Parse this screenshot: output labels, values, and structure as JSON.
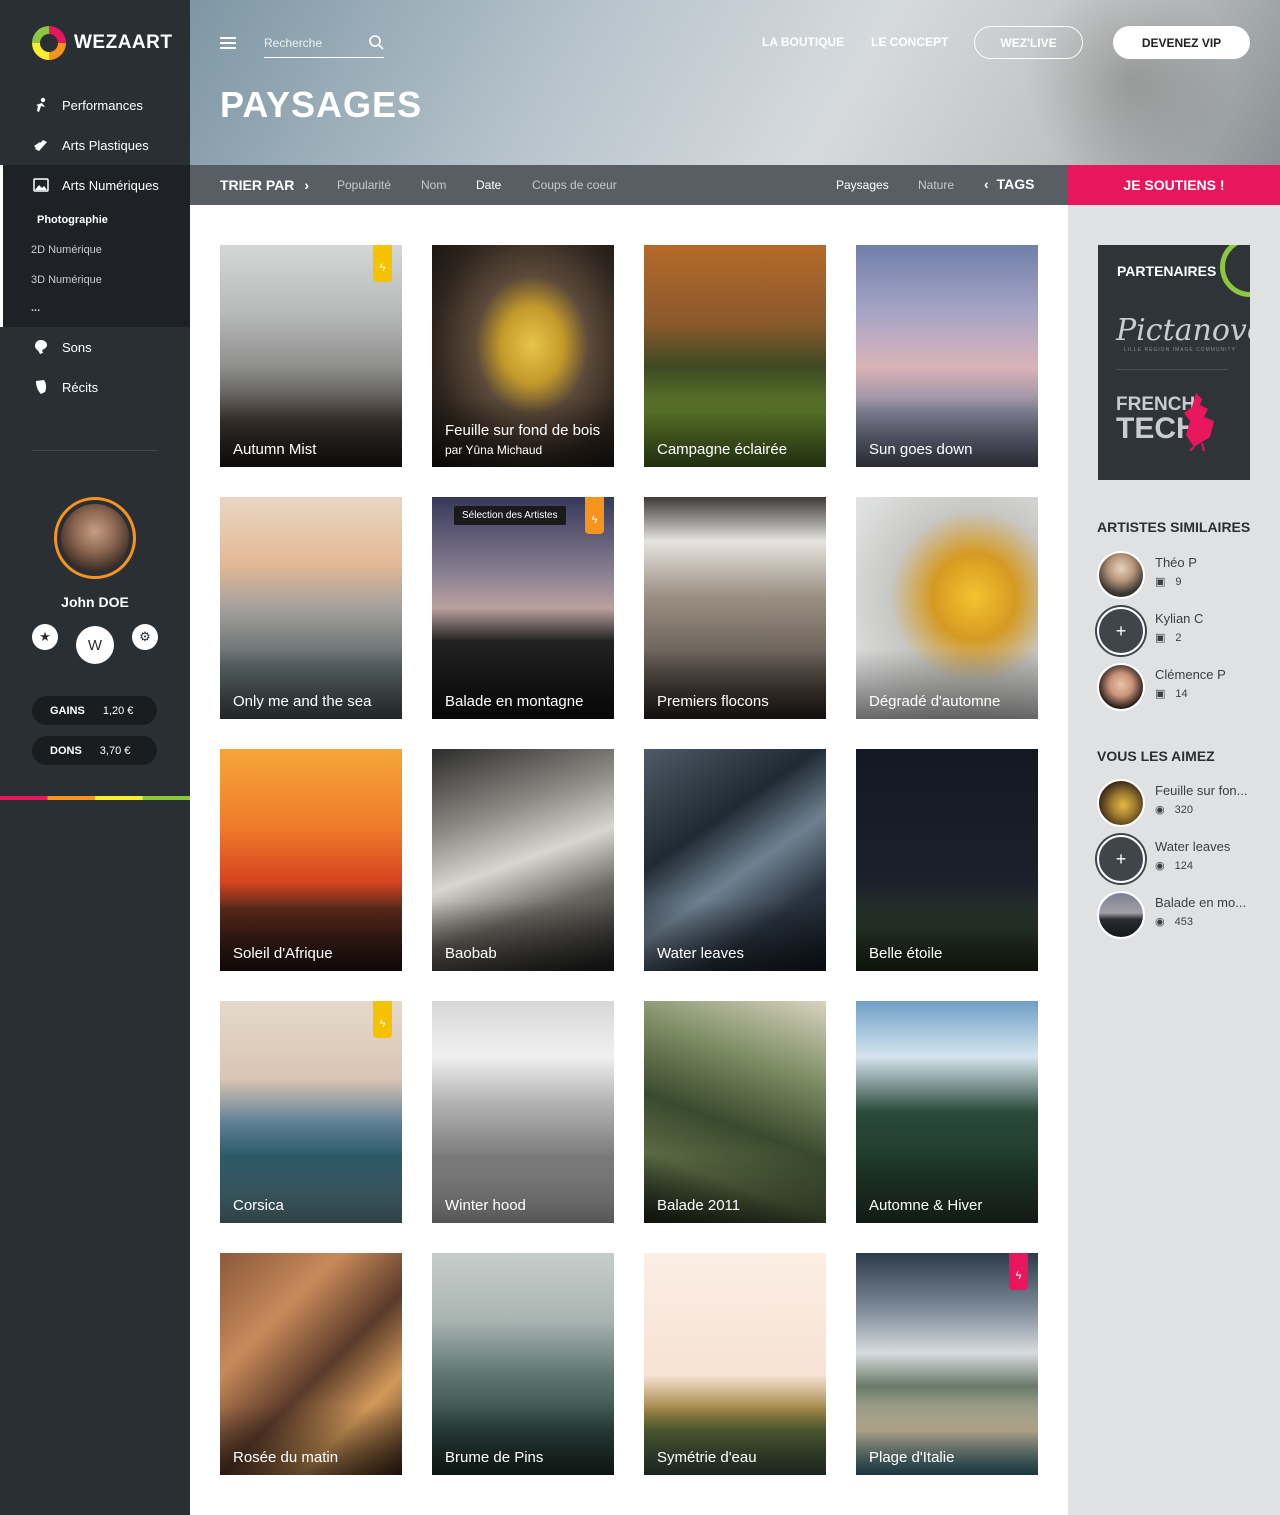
{
  "brand": {
    "name": "WEZAART"
  },
  "sidebar": {
    "nav": [
      {
        "label": "Performances",
        "icon": "performance-icon"
      },
      {
        "label": "Arts Plastiques",
        "icon": "palette-icon"
      },
      {
        "label": "Arts Numériques",
        "icon": "image-icon"
      }
    ],
    "subnav": [
      "Photographie",
      "2D Numérique",
      "3D Numérique",
      "..."
    ],
    "nav2": [
      {
        "label": "Sons",
        "icon": "sound-icon"
      },
      {
        "label": "Récits",
        "icon": "book-icon"
      }
    ],
    "user": {
      "name": "John DOE",
      "w_label": "W"
    },
    "gains": {
      "label": "GAINS",
      "value": "1,20 €"
    },
    "dons": {
      "label": "DONS",
      "value": "3,70 €"
    }
  },
  "header": {
    "search_placeholder": "Recherche",
    "boutique": "LA BOUTIQUE",
    "concept": "LE CONCEPT",
    "live": "WEZ'LIVE",
    "vip": "DEVENEZ VIP",
    "title": "PAYSAGES"
  },
  "filter": {
    "trier": "TRIER PAR",
    "options": [
      "Popularité",
      "Nom",
      "Date",
      "Coups de coeur"
    ],
    "active": "Date",
    "tag_options": [
      "Paysages",
      "Nature"
    ],
    "tags": "TAGS",
    "support": "JE SOUTIENS !"
  },
  "grid": [
    {
      "title": "Autumn Mist",
      "badge": "#f5c200"
    },
    {
      "title": "Feuille sur fond de bois",
      "subtitle": "par Yûna Michaud"
    },
    {
      "title": "Campagne éclairée"
    },
    {
      "title": "Sun goes down"
    },
    {
      "title": "Only me and the sea"
    },
    {
      "title": "Balade en montagne",
      "badge": "#f7941d",
      "tag": "Sélection des Artistes"
    },
    {
      "title": "Premiers flocons"
    },
    {
      "title": "Dégradé d'automne"
    },
    {
      "title": "Soleil d'Afrique"
    },
    {
      "title": "Baobab"
    },
    {
      "title": "Water leaves"
    },
    {
      "title": "Belle étoile"
    },
    {
      "title": "Corsica",
      "badge": "#f5c200"
    },
    {
      "title": "Winter hood"
    },
    {
      "title": "Balade 2011"
    },
    {
      "title": "Automne & Hiver"
    },
    {
      "title": "Rosée du matin"
    },
    {
      "title": "Brume de Pins"
    },
    {
      "title": "Symétrie d'eau"
    },
    {
      "title": "Plage d'Italie",
      "badge": "#e8175d"
    }
  ],
  "right": {
    "partners_title": "PARTENAIRES",
    "pictanovo": "Pictanovo",
    "pictanovo_sub": "LILLE RÉGION IMAGE COMMUNITY",
    "ft1": "FRENCH",
    "ft2": "TECH",
    "similar_title": "ARTISTES SIMILAIRES",
    "similar": [
      {
        "name": "Théo P",
        "count": "9"
      },
      {
        "name": "Kylian C",
        "count": "2"
      },
      {
        "name": "Clémence P",
        "count": "14"
      }
    ],
    "liked_title": "VOUS LES AIMEZ",
    "liked": [
      {
        "name": "Feuille sur fon...",
        "count": "320"
      },
      {
        "name": "Water leaves",
        "count": "124"
      },
      {
        "name": "Balade en mo...",
        "count": "453"
      }
    ]
  }
}
